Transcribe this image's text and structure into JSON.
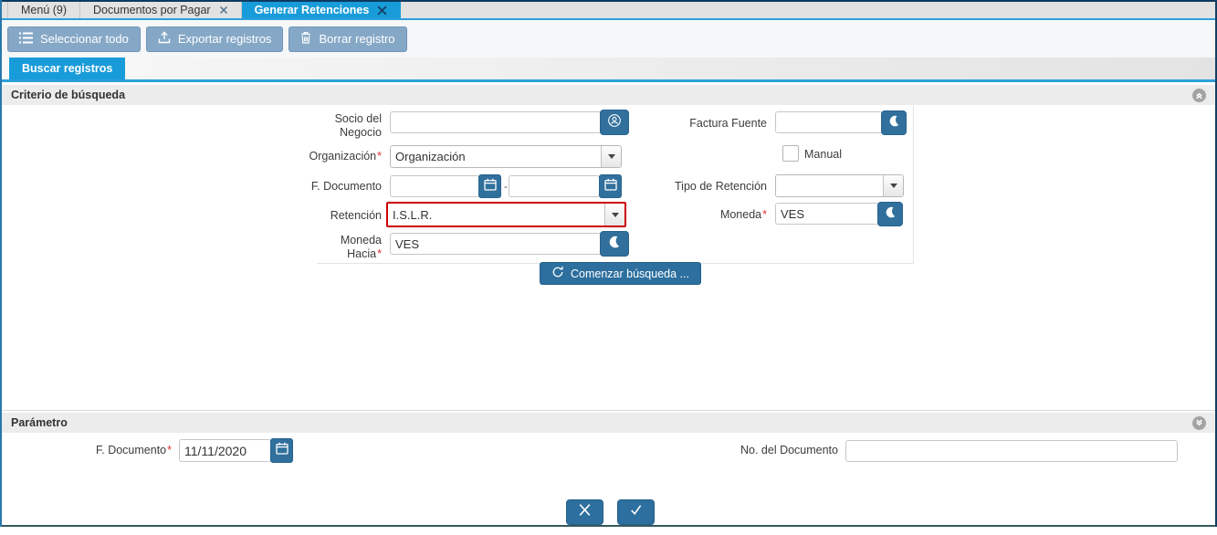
{
  "tab_bar": {
    "tabs": [
      {
        "label": "Menú (9)"
      },
      {
        "label": "Documentos por Pagar"
      },
      {
        "label": "Generar Retenciones"
      }
    ]
  },
  "toolbar": {
    "buttons": [
      {
        "label": "Seleccionar todo",
        "icon": "select-all-list-icon"
      },
      {
        "label": "Exportar registros",
        "icon": "export-upload-icon"
      },
      {
        "label": "Borrar registro",
        "icon": "trash-icon"
      }
    ]
  },
  "subtab": {
    "label": "Buscar registros"
  },
  "criteria": {
    "title": "Criterio de búsqueda",
    "required_marker": "*",
    "business_partner_label": "Socio del Negocio",
    "business_partner_value": "",
    "source_invoice_label": "Factura Fuente",
    "source_invoice_value": "",
    "organization_label": "Organización",
    "organization_value": "Organización",
    "manual_label": "Manual",
    "manual_checked": false,
    "doc_date_label": "F. Documento",
    "doc_date_from": "",
    "doc_date_to": "",
    "date_separator": "-",
    "retention_type_label": "Tipo de Retención",
    "retention_type_value": "",
    "retention_label": "Retención",
    "retention_value": "I.S.L.R.",
    "currency_label": "Moneda",
    "currency_value": "VES",
    "currency_to_label": "Moneda Hacia",
    "currency_to_value": "VES",
    "search_button_label": "Comenzar búsqueda ..."
  },
  "parameter": {
    "title": "Parámetro",
    "doc_date_label": "F. Documento",
    "doc_date_value": "11/11/2020",
    "doc_number_label": "No. del Documento",
    "doc_number_value": ""
  },
  "icons": {
    "tab_close": "close-icon",
    "business_partner_button": "business-partner-icon",
    "zoom_buttons": "crescent-zoom-icon",
    "date_buttons": "calendar-icon",
    "search_button": "refresh-icon",
    "criteria_collapse": "chevron-double-up-icon",
    "parameter_expand": "chevron-double-down-icon",
    "cancel": "x-icon",
    "confirm": "check-icon"
  },
  "colors": {
    "active_tab": "#189cd9",
    "tab_underline": "#2ba0da",
    "toolbar_button": "#86a8c7",
    "field_button": "#31709d",
    "action_button": "#2d6f9e",
    "error_border": "#cc0000",
    "required": "#e03030",
    "section_header_bg": "#ececec",
    "window_top_border": "#0d3a5f"
  }
}
